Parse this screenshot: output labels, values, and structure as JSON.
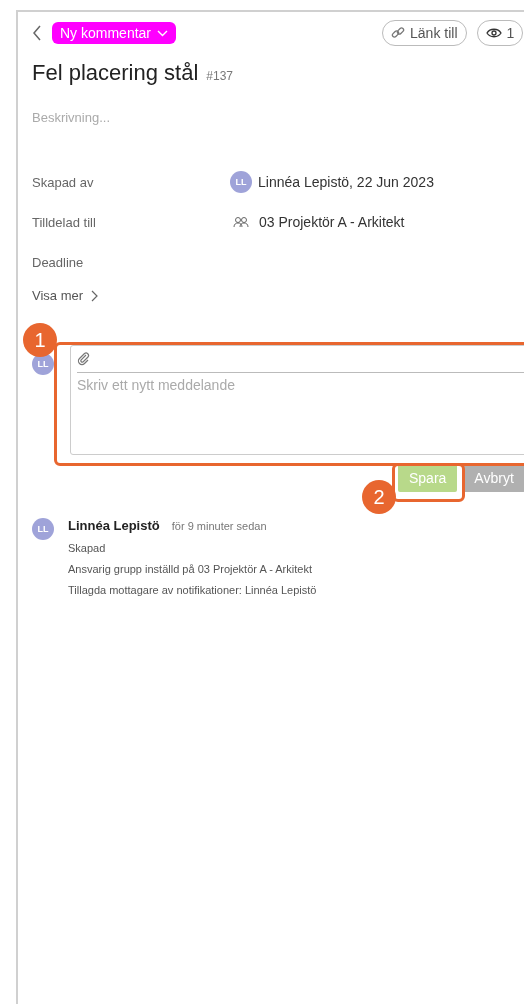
{
  "header": {
    "status": "Ny kommentar",
    "link_button": "Länk till",
    "watchers": "1"
  },
  "title": "Fel placering stål",
  "number": "#137",
  "description": {
    "placeholder": "Beskrivning..."
  },
  "fields": [
    {
      "kind": "user",
      "label": "Skapad av",
      "avatar": "LL",
      "value": "Linnéa Lepistö, 22 Jun 2023"
    },
    {
      "kind": "group",
      "label": "Tilldelad till",
      "value": "03 Projektör A - Arkitekt"
    },
    {
      "kind": "empty",
      "label": "Deadline"
    }
  ],
  "show_more": "Visa mer",
  "comment": {
    "avatar": "LL",
    "placeholder": "Skriv ett nytt meddelande",
    "save": "Spara",
    "cancel": "Avbryt"
  },
  "activity": [
    {
      "avatar": "LL",
      "author": "Linnéa Lepistö",
      "time": "för 9 minuter sedan",
      "lines": [
        "Skapad",
        "Ansvarig grupp inställd på 03 Projektör A - Arkitekt",
        "Tillagda mottagare av notifikationer: Linnéa Lepistö"
      ]
    }
  ],
  "annotations": [
    {
      "label": "1"
    },
    {
      "label": "2"
    }
  ]
}
